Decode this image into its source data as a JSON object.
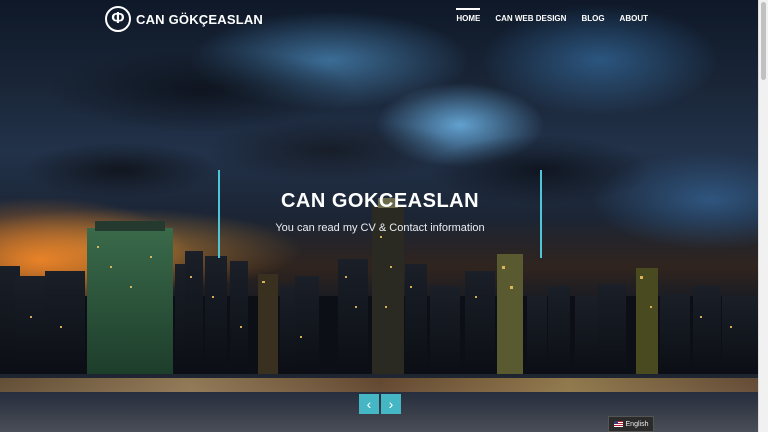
{
  "header": {
    "logo_text": "CAN GÖKÇEASLAN",
    "logo_icon": "phi-symbol-icon",
    "nav": [
      {
        "label": "HOME",
        "active": true
      },
      {
        "label": "CAN WEB DESIGN",
        "active": false
      },
      {
        "label": "BLOG",
        "active": false
      },
      {
        "label": "ABOUT",
        "active": false
      }
    ]
  },
  "hero": {
    "title": "CAN GOKCEASLAN",
    "subtitle": "You can read my CV & Contact information",
    "accent_color": "#45b6c4"
  },
  "slider": {
    "prev_icon": "chevron-left-icon",
    "next_icon": "chevron-right-icon",
    "prev_glyph": "‹",
    "next_glyph": "›"
  },
  "language": {
    "label": "English",
    "flag_icon": "us-flag-icon"
  }
}
